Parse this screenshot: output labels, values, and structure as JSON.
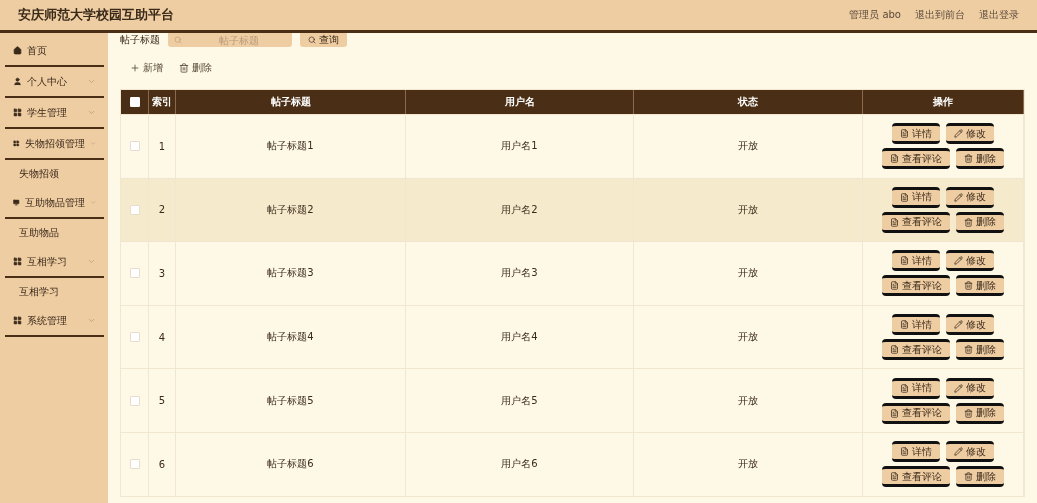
{
  "header": {
    "title": "安庆师范大学校园互助平台",
    "links": [
      "管理员 abo",
      "退出到前台",
      "退出登录"
    ]
  },
  "sidebar": {
    "items": [
      {
        "label": "首页",
        "expandable": false
      },
      {
        "label": "个人中心",
        "expandable": true
      },
      {
        "label": "学生管理",
        "expandable": true
      },
      {
        "label": "失物招领管理",
        "expandable": true,
        "children": [
          {
            "label": "失物招领"
          }
        ]
      },
      {
        "label": "互助物品管理",
        "expandable": true,
        "children": [
          {
            "label": "互助物品"
          }
        ]
      },
      {
        "label": "互相学习",
        "expandable": true,
        "children": [
          {
            "label": "互相学习"
          }
        ]
      },
      {
        "label": "系统管理",
        "expandable": true
      }
    ]
  },
  "search": {
    "label": "帖子标题",
    "placeholder": "帖子标题",
    "button": "查询"
  },
  "toolbar": {
    "add": "新增",
    "delete": "删除"
  },
  "table": {
    "all_checked": false,
    "columns": [
      "索引",
      "帖子标题",
      "用户名",
      "状态",
      "操作"
    ],
    "rows": [
      {
        "index": "1",
        "title": "帖子标题1",
        "user": "用户名1",
        "status": "开放",
        "checked": false,
        "hovered": false,
        "actions": [
          "详情",
          "修改",
          "查看评论",
          "删除"
        ]
      },
      {
        "index": "2",
        "title": "帖子标题2",
        "user": "用户名2",
        "status": "开放",
        "checked": false,
        "hovered": true,
        "actions": [
          "详情",
          "修改",
          "查看评论",
          "删除"
        ]
      },
      {
        "index": "3",
        "title": "帖子标题3",
        "user": "用户名3",
        "status": "开放",
        "checked": false,
        "hovered": false,
        "actions": [
          "详情",
          "修改",
          "查看评论",
          "删除"
        ]
      },
      {
        "index": "4",
        "title": "帖子标题4",
        "user": "用户名4",
        "status": "开放",
        "checked": false,
        "hovered": false,
        "actions": [
          "详情",
          "修改",
          "查看评论",
          "删除"
        ]
      },
      {
        "index": "5",
        "title": "帖子标题5",
        "user": "用户名5",
        "status": "开放",
        "checked": false,
        "hovered": false,
        "actions": [
          "详情",
          "修改",
          "查看评论",
          "删除"
        ]
      },
      {
        "index": "6",
        "title": "帖子标题6",
        "user": "用户名6",
        "status": "开放",
        "checked": false,
        "hovered": false,
        "actions": [
          "详情",
          "修改",
          "查看评论",
          "删除"
        ]
      }
    ]
  }
}
